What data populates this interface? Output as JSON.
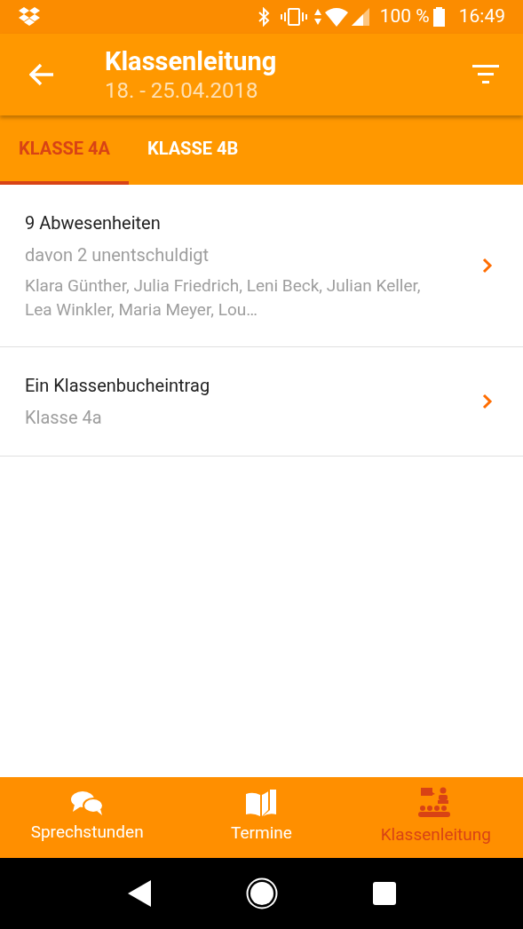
{
  "status_bar": {
    "battery": "100 %",
    "time": "16:49"
  },
  "app_bar": {
    "title": "Klassenleitung",
    "subtitle": "18. - 25.04.2018"
  },
  "tabs": [
    {
      "label": "KLASSE 4A",
      "selected": true
    },
    {
      "label": "KLASSE 4B",
      "selected": false
    }
  ],
  "items": [
    {
      "title": "9 Abwesenheiten",
      "subtitle": "davon 2 unentschuldigt",
      "detail": "Klara Günther, Julia Friedrich, Leni Beck, Julian Keller, Lea Winkler, Maria Meyer, Lou…"
    },
    {
      "title": "Ein Klassenbucheintrag",
      "subtitle": "Klasse 4a"
    }
  ],
  "bottom_nav": [
    {
      "label": "Sprechstunden",
      "selected": false
    },
    {
      "label": "Termine",
      "selected": false
    },
    {
      "label": "Klassenleitung",
      "selected": true
    }
  ]
}
